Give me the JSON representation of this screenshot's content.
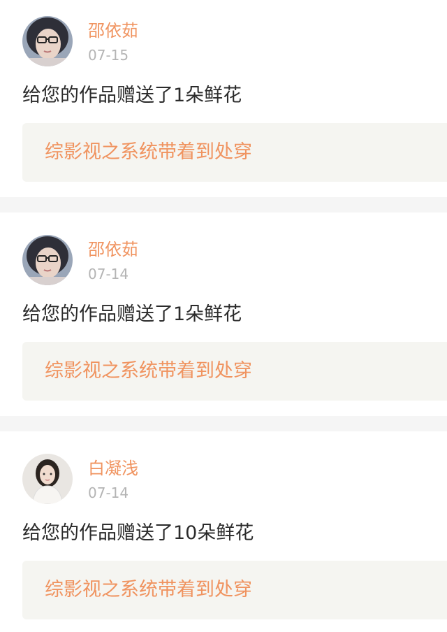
{
  "posts": [
    {
      "user": {
        "name": "邵依茹",
        "avatar_icon": "girl-with-glasses-avatar-icon"
      },
      "date": "07-15",
      "message": "给您的作品赠送了1朵鲜花",
      "work_title": "综影视之系统带着到处穿"
    },
    {
      "user": {
        "name": "邵依茹",
        "avatar_icon": "girl-with-glasses-avatar-icon"
      },
      "date": "07-14",
      "message": "给您的作品赠送了1朵鲜花",
      "work_title": "综影视之系统带着到处穿"
    },
    {
      "user": {
        "name": "白凝浅",
        "avatar_icon": "woman-in-white-avatar-icon"
      },
      "date": "07-14",
      "message": "给您的作品赠送了10朵鲜花",
      "work_title": "综影视之系统带着到处穿"
    }
  ],
  "colors": {
    "accent": "#f0935f",
    "date": "#b4b4b4",
    "text": "#2b2b2b",
    "work_card_bg": "#f5f5f1",
    "separator": "#f5f5f5"
  }
}
